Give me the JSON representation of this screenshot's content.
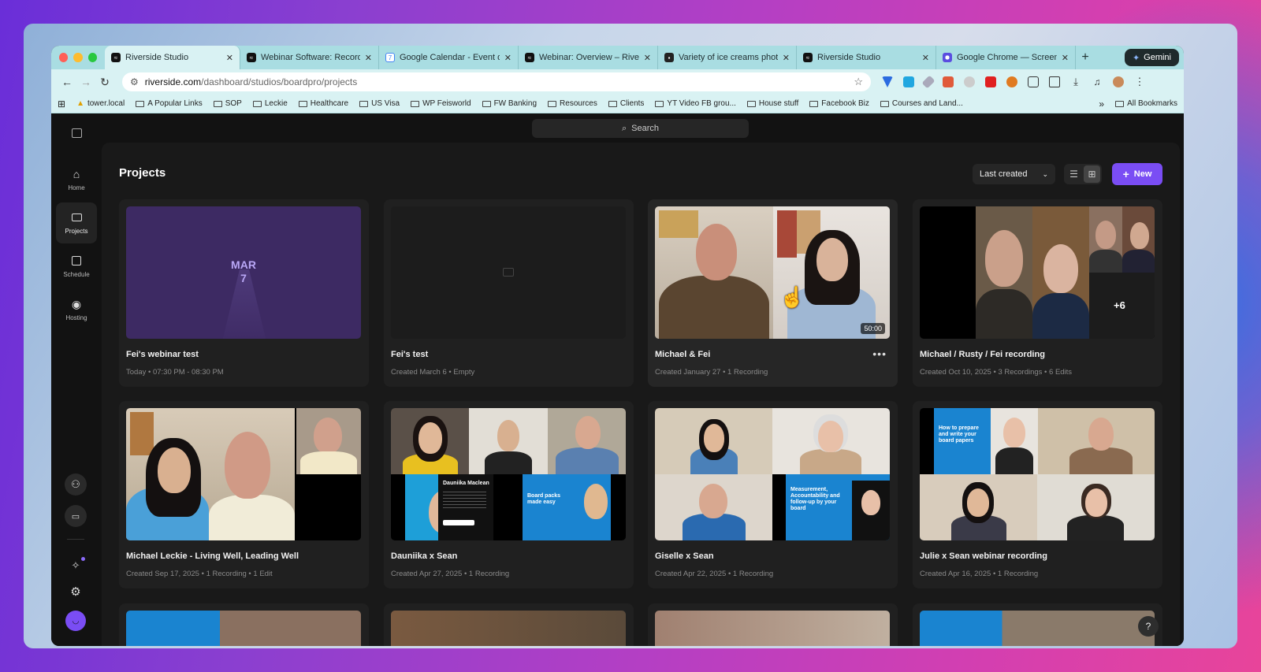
{
  "browser": {
    "tabs": [
      {
        "title": "Riverside Studio",
        "active": true,
        "favicon": "riverside-icon"
      },
      {
        "title": "Webinar Software: Record, I",
        "favicon": "riverside-icon"
      },
      {
        "title": "Google Calendar - Event de",
        "favicon": "calendar-icon"
      },
      {
        "title": "Webinar: Overview – Riversi",
        "favicon": "riverside-icon"
      },
      {
        "title": "Variety of ice creams photo",
        "favicon": "unsplash-icon"
      },
      {
        "title": "Riverside Studio",
        "favicon": "riverside-icon"
      },
      {
        "title": "Google Chrome — Screen S",
        "favicon": "chrome-icon"
      }
    ],
    "gemini_label": "Gemini",
    "url_domain": "riverside.com",
    "url_path": "/dashboard/studios/boardpro/projects",
    "bookmarks": [
      "tower.local",
      "A Popular Links",
      "SOP",
      "Leckie",
      "Healthcare",
      "US Visa",
      "WP Feisworld",
      "FW Banking",
      "Resources",
      "Clients",
      "YT Video FB grou...",
      "House stuff",
      "Facebook Biz",
      "Courses and Land..."
    ],
    "all_bookmarks": "All Bookmarks",
    "bookmarks_overflow": "»"
  },
  "app": {
    "search_label": "Search",
    "rail": [
      {
        "label": "Home",
        "icon": "home-icon"
      },
      {
        "label": "Projects",
        "icon": "folder-icon",
        "active": true
      },
      {
        "label": "Schedule",
        "icon": "calendar-icon"
      },
      {
        "label": "Hosting",
        "icon": "broadcast-icon"
      }
    ],
    "page_title": "Projects",
    "sort_label": "Last created",
    "new_label": "New",
    "help_label": "?",
    "projects": [
      {
        "title": "Fei's webinar test",
        "meta": "Today • 07:30 PM - 08:30 PM",
        "thumb": "date",
        "date_month": "MAR",
        "date_day": "7"
      },
      {
        "title": "Fei's test",
        "meta": "Created March 6 • Empty",
        "thumb": "empty"
      },
      {
        "title": "Michael & Fei",
        "meta": "Created January 27 • 1 Recording",
        "thumb": "two",
        "duration": "50:00",
        "more": "•••"
      },
      {
        "title": "Michael / Rusty / Fei recording",
        "meta": "Created Oct 10, 2025 • 3 Recordings • 6 Edits",
        "thumb": "multi",
        "extra": "+6"
      },
      {
        "title": "Michael Leckie - Living Well, Leading Well",
        "meta": "Created Sep 17, 2025 • 1 Recording • 1 Edit",
        "thumb": "leckie"
      },
      {
        "title": "Dauniika x Sean",
        "meta": "Created Apr 27, 2025 • 1 Recording",
        "thumb": "grid",
        "slide_name": "Dauniika Maclean",
        "slide_text": "Board packs made easy"
      },
      {
        "title": "Giselle x Sean",
        "meta": "Created Apr 22, 2025 • 1 Recording",
        "thumb": "grid",
        "slide_text": "Measurement, Accountability and follow-up by your board"
      },
      {
        "title": "Julie x Sean webinar recording",
        "meta": "Created Apr 16, 2025 • 1 Recording",
        "thumb": "grid",
        "slide_text": "How to prepare and write your board papers"
      }
    ]
  },
  "colors": {
    "accent": "#7a4df4",
    "tabbar": "#a9dde2",
    "app_bg": "#121212",
    "card_bg": "#202020"
  }
}
